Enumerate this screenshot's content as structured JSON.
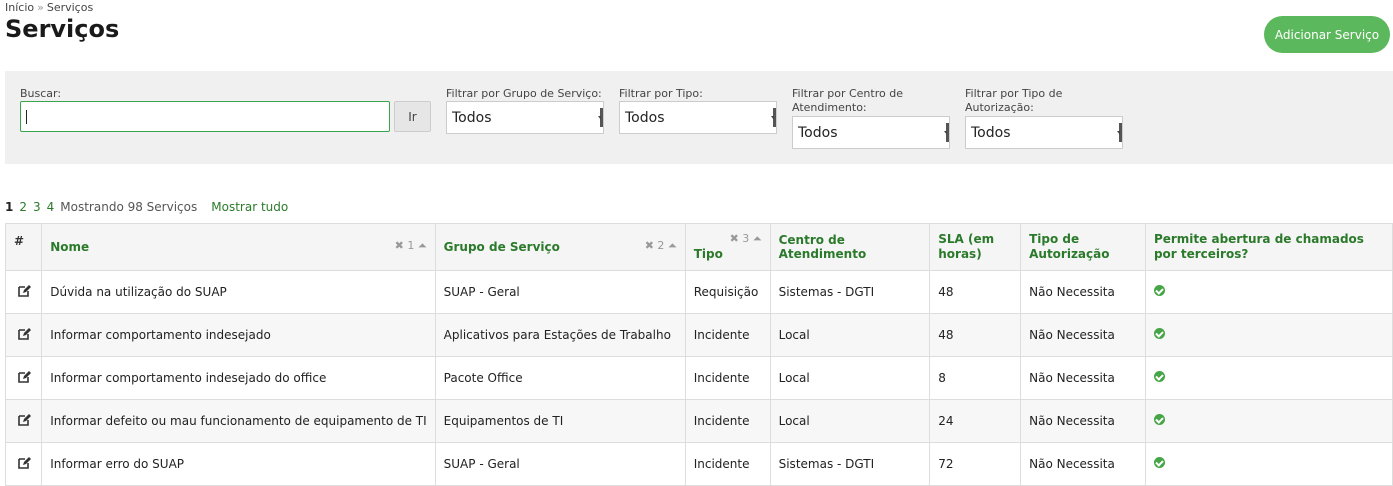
{
  "breadcrumb": {
    "home": "Início",
    "separator": "»",
    "current": "Serviços"
  },
  "page_title": "Serviços",
  "add_button": "Adicionar Serviço",
  "filters": {
    "search_label": "Buscar:",
    "search_value": "",
    "go_button": "Ir",
    "group_label": "Filtrar por Grupo de Serviço:",
    "group_value": "Todos",
    "type_label": "Filtrar por Tipo:",
    "type_value": "Todos",
    "center_label": "Filtrar por Centro de Atendimento:",
    "center_value": "Todos",
    "auth_label": "Filtrar por Tipo de Autorização:",
    "auth_value": "Todos"
  },
  "pagination": {
    "pages": [
      "1",
      "2",
      "3",
      "4"
    ],
    "current": "1",
    "info": "Mostrando 98 Serviços",
    "show_all": "Mostrar tudo"
  },
  "table": {
    "headers": {
      "hash": "#",
      "nome": "Nome",
      "nome_sort": "✖ 1 ⏶",
      "grupo": "Grupo de Serviço",
      "grupo_sort": "✖ 2 ⏶",
      "tipo": "Tipo",
      "tipo_sort": "✖ 3 ⏶",
      "centro": "Centro de Atendimento",
      "sla": "SLA (em horas)",
      "autorizacao": "Tipo de Autorização",
      "terceiros": "Permite abertura de chamados por terceiros?"
    },
    "rows": [
      {
        "nome": "Dúvida na utilização do SUAP",
        "grupo": "SUAP - Geral",
        "tipo": "Requisição",
        "centro": "Sistemas - DGTI",
        "sla": "48",
        "autorizacao": "Não Necessita"
      },
      {
        "nome": "Informar comportamento indesejado",
        "grupo": "Aplicativos para Estações de Trabalho",
        "tipo": "Incidente",
        "centro": "Local",
        "sla": "48",
        "autorizacao": "Não Necessita"
      },
      {
        "nome": "Informar comportamento indesejado do office",
        "grupo": "Pacote Office",
        "tipo": "Incidente",
        "centro": "Local",
        "sla": "8",
        "autorizacao": "Não Necessita"
      },
      {
        "nome": "Informar defeito ou mau funcionamento de equipamento de TI",
        "grupo": "Equipamentos de TI",
        "tipo": "Incidente",
        "centro": "Local",
        "sla": "24",
        "autorizacao": "Não Necessita"
      },
      {
        "nome": "Informar erro do SUAP",
        "grupo": "SUAP - Geral",
        "tipo": "Incidente",
        "centro": "Sistemas - DGTI",
        "sla": "72",
        "autorizacao": "Não Necessita"
      }
    ]
  },
  "icons": {
    "edit": "edit-icon",
    "check": "check-circle-icon"
  },
  "colors": {
    "accent": "#5cb85c",
    "link": "#2b7a2b"
  }
}
